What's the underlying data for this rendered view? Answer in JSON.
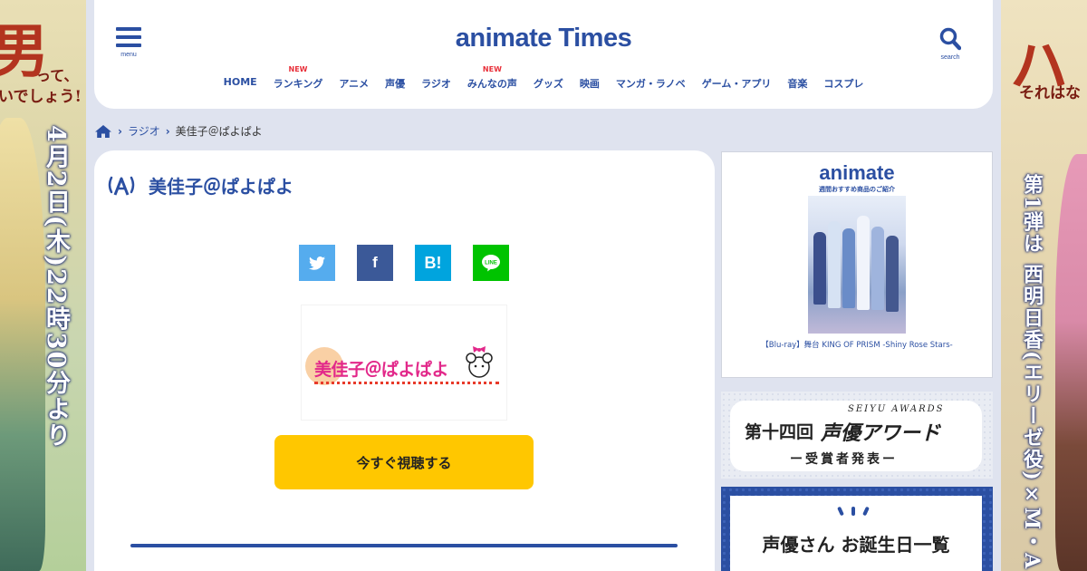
{
  "ads": {
    "left": {
      "big_char": "男",
      "line1": "って、",
      "line2": "いでしょう!",
      "vertical": "4月2日(木)22時30分より"
    },
    "right": {
      "big_char": "ハ",
      "line1": "それはな",
      "vertical": "第1弾は 西明日香(エリーゼ役)×M・A"
    }
  },
  "header": {
    "menu_label": "menu",
    "search_label": "search",
    "logo_prefix": "an",
    "logo_i": "i",
    "logo_suffix": "mate Times",
    "nav": [
      {
        "label": "HOME",
        "badge": ""
      },
      {
        "label": "ランキング",
        "badge": "NEW"
      },
      {
        "label": "アニメ",
        "badge": ""
      },
      {
        "label": "声優",
        "badge": ""
      },
      {
        "label": "ラジオ",
        "badge": ""
      },
      {
        "label": "みんなの声",
        "badge": "NEW"
      },
      {
        "label": "グッズ",
        "badge": ""
      },
      {
        "label": "映画",
        "badge": ""
      },
      {
        "label": "マンガ・ラノベ",
        "badge": ""
      },
      {
        "label": "ゲーム・アプリ",
        "badge": ""
      },
      {
        "label": "音楽",
        "badge": ""
      },
      {
        "label": "コスプレ",
        "badge": ""
      }
    ]
  },
  "breadcrumb": {
    "items": [
      "ラジオ"
    ],
    "current": "美佳子＠ぱよぱよ"
  },
  "main": {
    "title": "美佳子＠ぱよぱよ",
    "thumbnail_text": "美佳子＠ぱよぱよ",
    "listen_button": "今すぐ視聴する",
    "share": [
      "twitter",
      "facebook",
      "hatena",
      "line"
    ],
    "hatena_label": "B!",
    "facebook_label": "f",
    "line_label": "LINE"
  },
  "sidebar": {
    "ad_logo": "animate",
    "ad_subtitle": "週間おすすめ商品のご紹介",
    "ad_caption": "【Blu-ray】舞台 KING OF PRISM -Shiny Rose Stars-",
    "award_kai": "第十四回",
    "award_en": "SEIYU AWARDS",
    "award_name": "声優アワード",
    "award_result": "ー受賞者発表ー",
    "birthday_title": "声優さん お誕生日一覧"
  },
  "colors": {
    "brand": "#2b4fa2",
    "accent_new": "#e8303a",
    "listen_button": "#ffc700",
    "twitter": "#55acee",
    "facebook": "#3b5998",
    "hatena": "#00a4de",
    "line": "#00c300"
  }
}
